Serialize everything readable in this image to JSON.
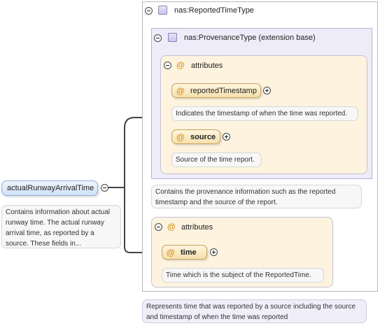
{
  "root": {
    "name": "actualRunwayArrivalTime",
    "doc": "Contains information about actual runway time. The actual runway arrival time, as reported by a source. These fields in..."
  },
  "reported_type": {
    "name": "nas:ReportedTimeType",
    "doc": "Represents time that was reported by a source including the source and timestamp of when the time was reported"
  },
  "provenance": {
    "name": "nas:ProvenanceType (extension base)",
    "doc": "Contains the provenance information such as the reported timestamp and the source of the report.",
    "attributes_label": "attributes",
    "attributes": [
      {
        "name": "reportedTimestamp",
        "doc": "Indicates the timestamp of when the time was reported."
      },
      {
        "name": "source",
        "doc": "Source of the time report.",
        "bold": true
      }
    ]
  },
  "time_group": {
    "attributes_label": "attributes",
    "attributes": [
      {
        "name": "time",
        "doc": "Time which is the subject of the ReportedTime.",
        "bold": true
      }
    ]
  },
  "colors": {
    "root_fill": "#dcebfb",
    "provenance_fill": "#eeecf8",
    "attributes_fill": "#fdf3df",
    "note_fill": "#f7f7f7",
    "note_purple": "#f0eef9"
  }
}
